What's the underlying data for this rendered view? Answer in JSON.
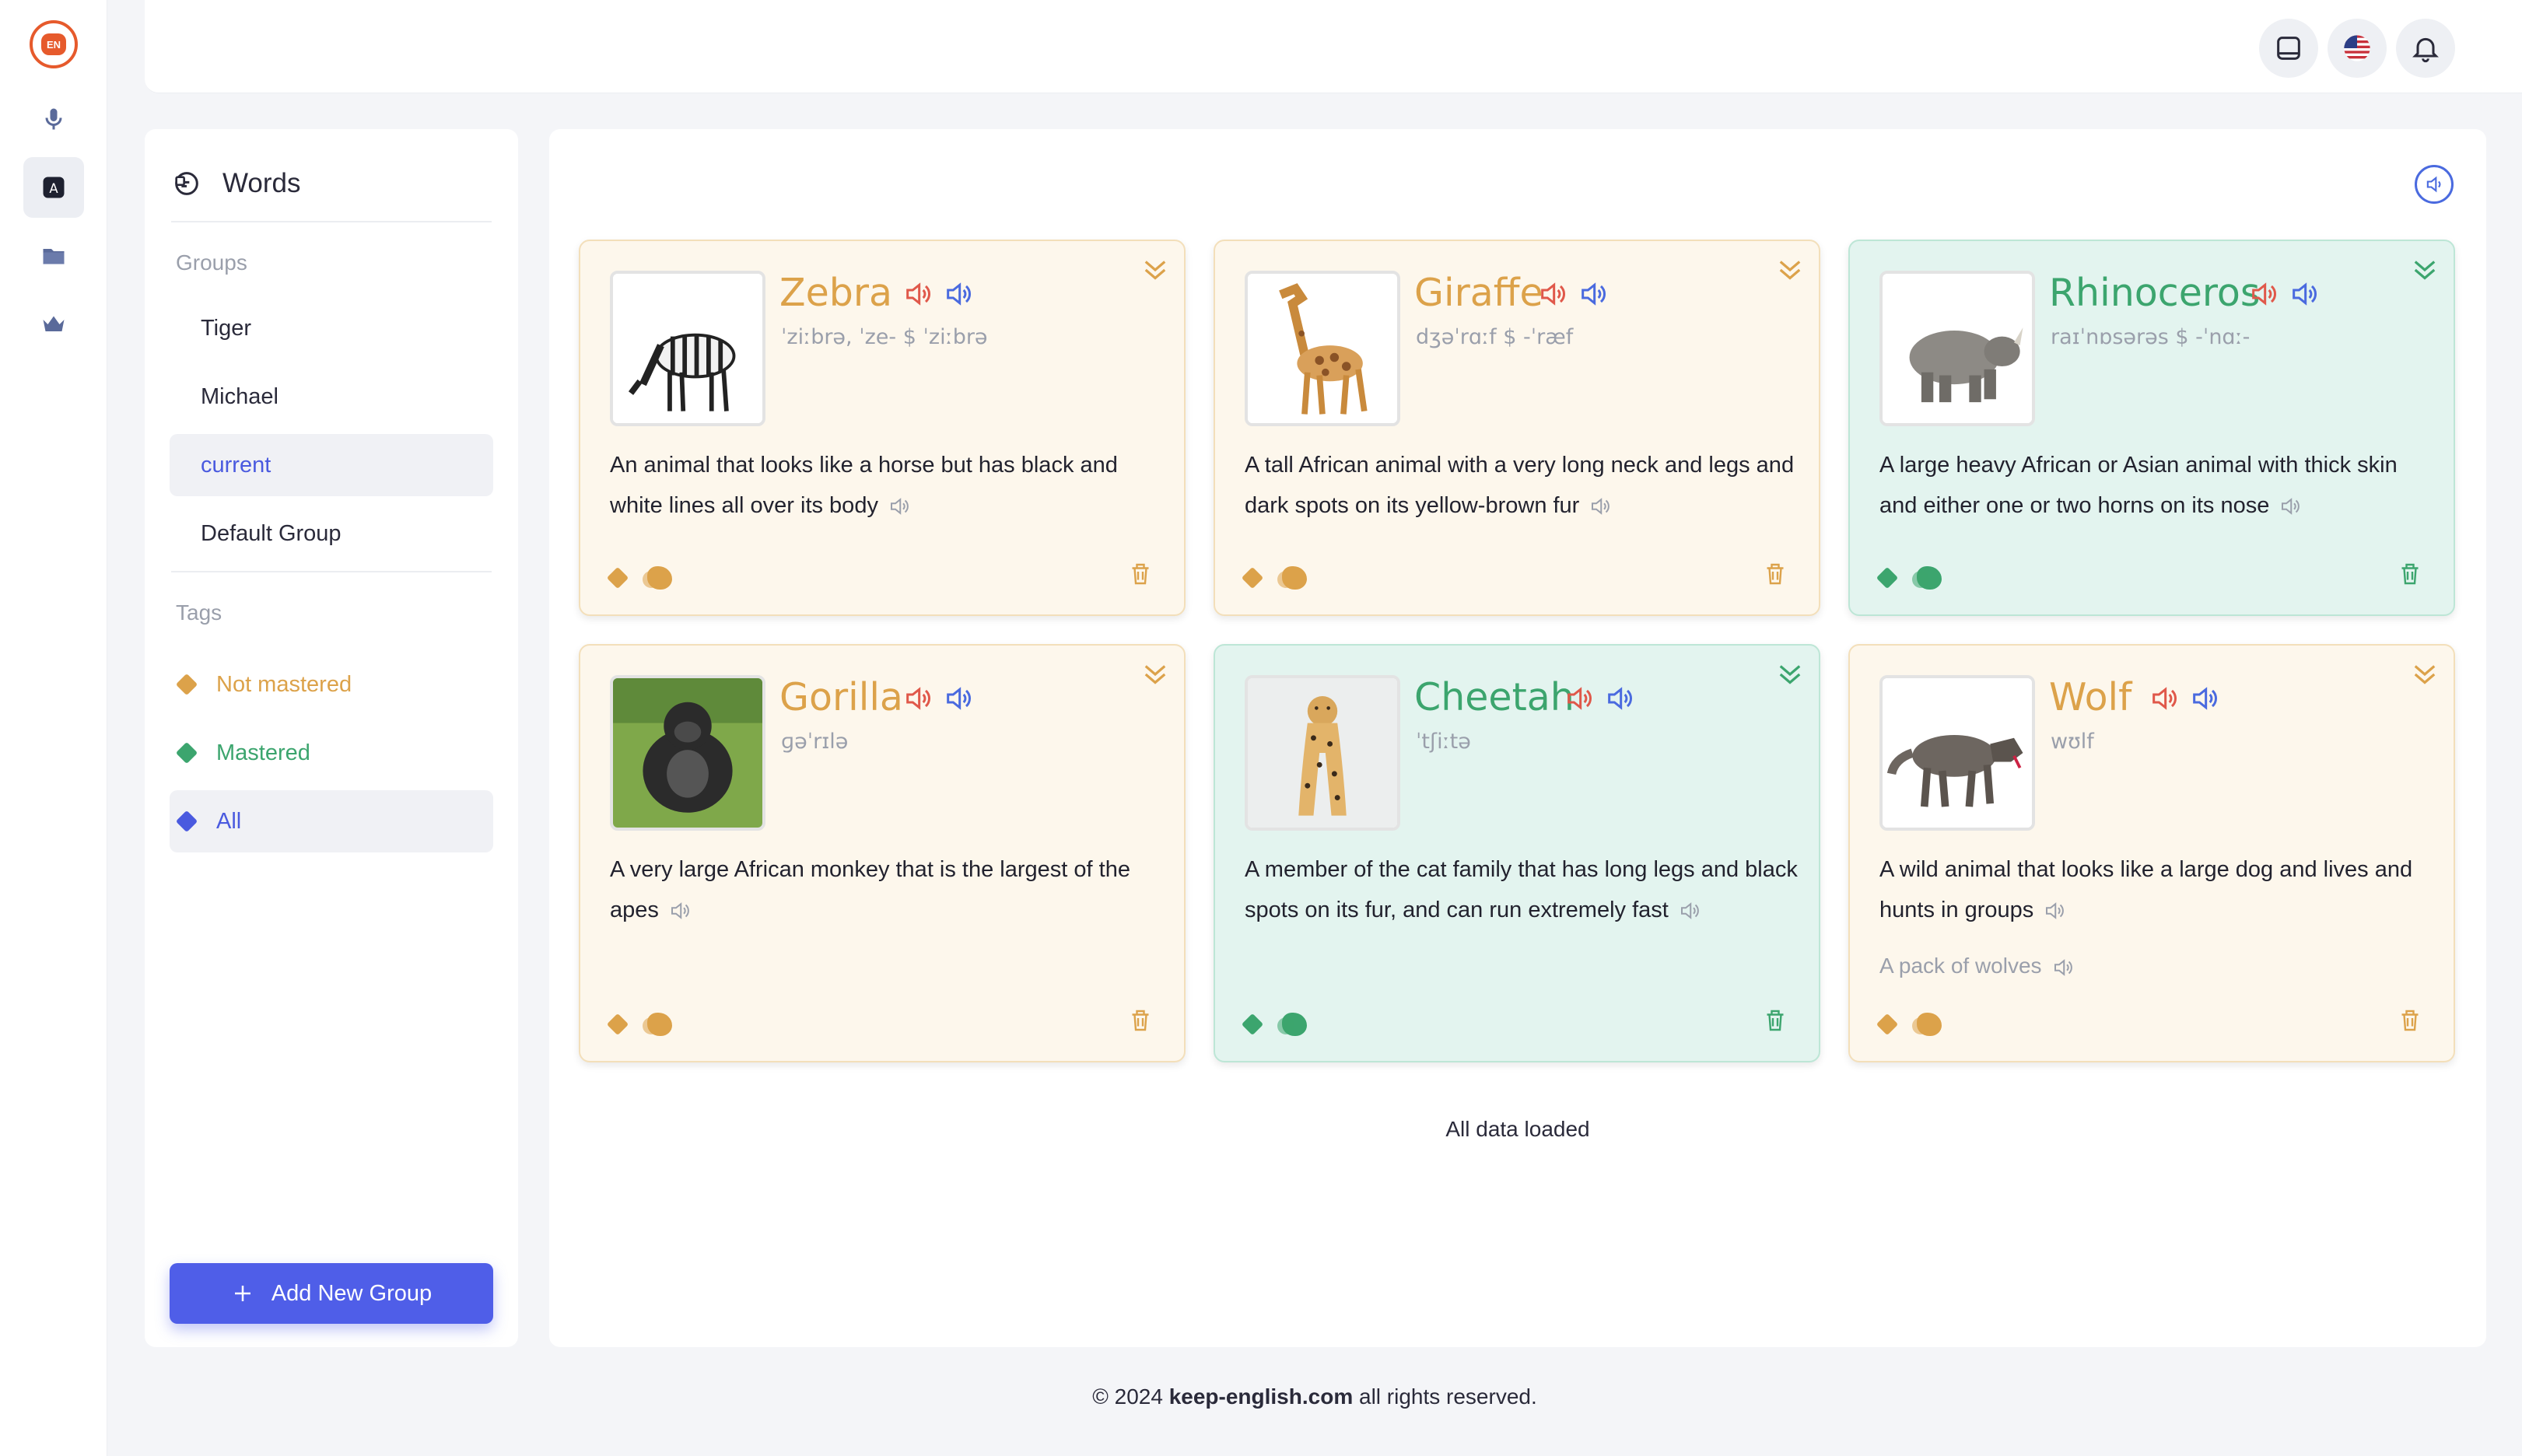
{
  "app": {
    "logo_text": "EN",
    "nav": [
      "microphone-icon",
      "alphabet-icon",
      "folder-icon",
      "crown-icon"
    ]
  },
  "header": {
    "buttons": [
      "tablet-icon",
      "us-flag-icon",
      "bell-icon"
    ],
    "avatar": "user-avatar"
  },
  "sidebar": {
    "title": "Words",
    "groups_label": "Groups",
    "groups": [
      {
        "label": "Tiger",
        "selected": false
      },
      {
        "label": "Michael",
        "selected": false
      },
      {
        "label": "current",
        "selected": true
      },
      {
        "label": "Default Group",
        "selected": false
      }
    ],
    "tags_label": "Tags",
    "tags": [
      {
        "label": "Not mastered",
        "color": "#dca24a",
        "selected": false
      },
      {
        "label": "Mastered",
        "color": "#3ca56e",
        "selected": false
      },
      {
        "label": "All",
        "color": "#4a5adf",
        "selected": true
      }
    ],
    "add_button": "Add New Group"
  },
  "cards": [
    {
      "word": "Zebra",
      "phonetic": "ˈziːbrə, ˈze- $ ˈziːbrə",
      "definition": "An animal that looks like a horse but has black and white lines all over its body",
      "example": "",
      "status": "not-mastered"
    },
    {
      "word": "Giraffe",
      "phonetic": "dʒəˈrɑːf $ -ˈræf",
      "definition": "A tall African animal with a very long neck and legs and dark spots on its yellow-brown fur",
      "example": "",
      "status": "not-mastered"
    },
    {
      "word": "Rhinoceros",
      "phonetic": "raɪˈnɒsərəs $ -ˈnɑː-",
      "definition": "A large heavy African or Asian animal with thick skin and either one or two horns on its nose",
      "example": "",
      "status": "mastered"
    },
    {
      "word": "Gorilla",
      "phonetic": "ɡəˈrɪlə",
      "definition": "A very large African monkey that is the largest of the apes",
      "example": "",
      "status": "not-mastered"
    },
    {
      "word": "Cheetah",
      "phonetic": "ˈtʃiːtə",
      "definition": "A member of the cat family that has long legs and black spots on its fur, and can run extremely fast",
      "example": "",
      "status": "mastered"
    },
    {
      "word": "Wolf",
      "phonetic": "wʊlf",
      "definition": "A wild animal that looks like a large dog and lives and hunts in groups",
      "example": "A pack of wolves",
      "status": "not-mastered"
    }
  ],
  "status_text": "All data loaded",
  "footer": {
    "prefix": "© 2024 ",
    "site": "keep-english.com",
    "suffix": " all rights reserved."
  },
  "colors": {
    "accent": "#4f5ee8",
    "not_mastered": "#dca24a",
    "mastered": "#3ca56e",
    "speaker_red": "#e0584a",
    "speaker_blue": "#4a6adf"
  }
}
